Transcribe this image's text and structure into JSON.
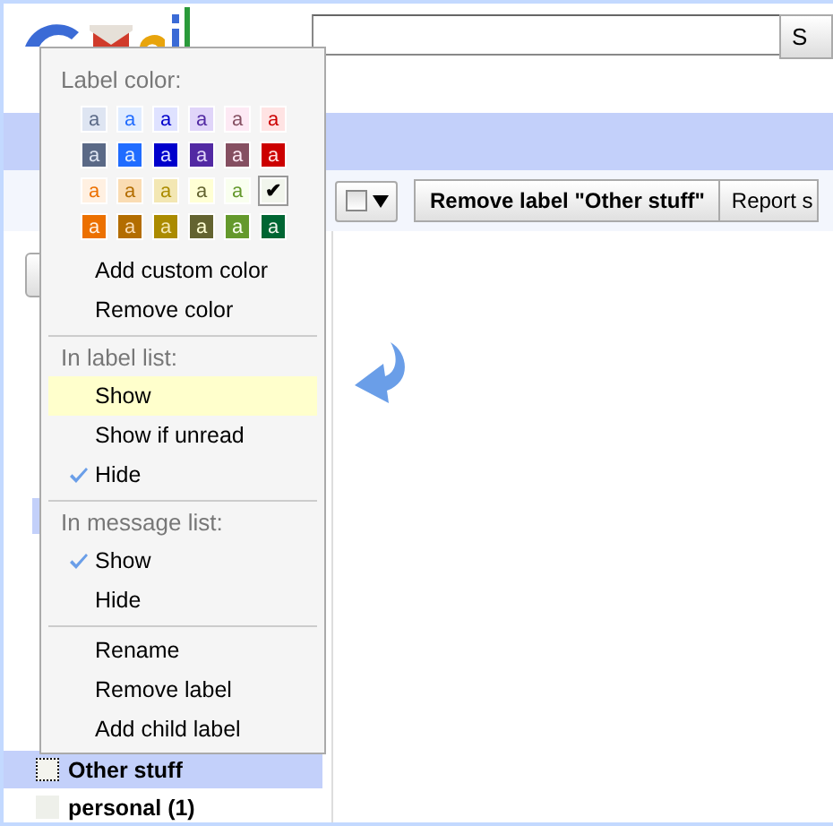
{
  "search": {
    "button": "S"
  },
  "toolbar": {
    "buttons": [
      "Remove label \"Other stuff\"",
      "Report s"
    ]
  },
  "labels": [
    {
      "name": "Other stuff",
      "selected": true
    },
    {
      "name": "personal (1)",
      "selected": false
    }
  ],
  "menu": {
    "color_title": "Label color:",
    "swatches": [
      {
        "color": "#dee5f2",
        "mark": "a",
        "selected": false
      },
      {
        "color": "#e0ecff",
        "mark": "a",
        "selected": false
      },
      {
        "color": "#dfe2ff",
        "mark": "a",
        "selected": false
      },
      {
        "color": "#e0d5f9",
        "mark": "a",
        "selected": false
      },
      {
        "color": "#fde9f4",
        "mark": "a",
        "selected": false
      },
      {
        "color": "#ffe3e3",
        "mark": "a",
        "selected": false
      },
      {
        "color": "#5a6986",
        "mark": "a",
        "selected": false
      },
      {
        "color": "#206cff",
        "mark": "a",
        "selected": false
      },
      {
        "color": "#0000cc",
        "mark": "a",
        "selected": false
      },
      {
        "color": "#5229a3",
        "mark": "a",
        "selected": false
      },
      {
        "color": "#854f61",
        "mark": "a",
        "selected": false
      },
      {
        "color": "#cc0000",
        "mark": "a",
        "selected": false
      },
      {
        "color": "#fff0e1",
        "mark": "a",
        "selected": false
      },
      {
        "color": "#fadcb3",
        "mark": "a",
        "selected": false
      },
      {
        "color": "#f3e7b3",
        "mark": "a",
        "selected": false
      },
      {
        "color": "#ffffd4",
        "mark": "a",
        "selected": false
      },
      {
        "color": "#f9ffef",
        "mark": "a",
        "selected": false
      },
      {
        "color": "#f1f5ec",
        "mark": "✔",
        "selected": true
      },
      {
        "color": "#ec7000",
        "mark": "a",
        "selected": false
      },
      {
        "color": "#b36d00",
        "mark": "a",
        "selected": false
      },
      {
        "color": "#ab8b00",
        "mark": "a",
        "selected": false
      },
      {
        "color": "#636330",
        "mark": "a",
        "selected": false
      },
      {
        "color": "#64992c",
        "mark": "a",
        "selected": false
      },
      {
        "color": "#006633",
        "mark": "a",
        "selected": false
      }
    ],
    "sections": [
      {
        "items": [
          {
            "label": "Add custom color",
            "checked": false,
            "hovered": false
          },
          {
            "label": "Remove color",
            "checked": false,
            "hovered": false
          }
        ]
      },
      {
        "title": "In label list:",
        "items": [
          {
            "label": "Show",
            "checked": false,
            "hovered": true
          },
          {
            "label": "Show if unread",
            "checked": false,
            "hovered": false
          },
          {
            "label": "Hide",
            "checked": true,
            "hovered": false
          }
        ]
      },
      {
        "title": "In message list:",
        "items": [
          {
            "label": "Show",
            "checked": true,
            "hovered": false
          },
          {
            "label": "Hide",
            "checked": false,
            "hovered": false
          }
        ]
      },
      {
        "items": [
          {
            "label": "Rename",
            "checked": false,
            "hovered": false
          },
          {
            "label": "Remove label",
            "checked": false,
            "hovered": false
          },
          {
            "label": "Add child label",
            "checked": false,
            "hovered": false
          }
        ]
      }
    ]
  }
}
